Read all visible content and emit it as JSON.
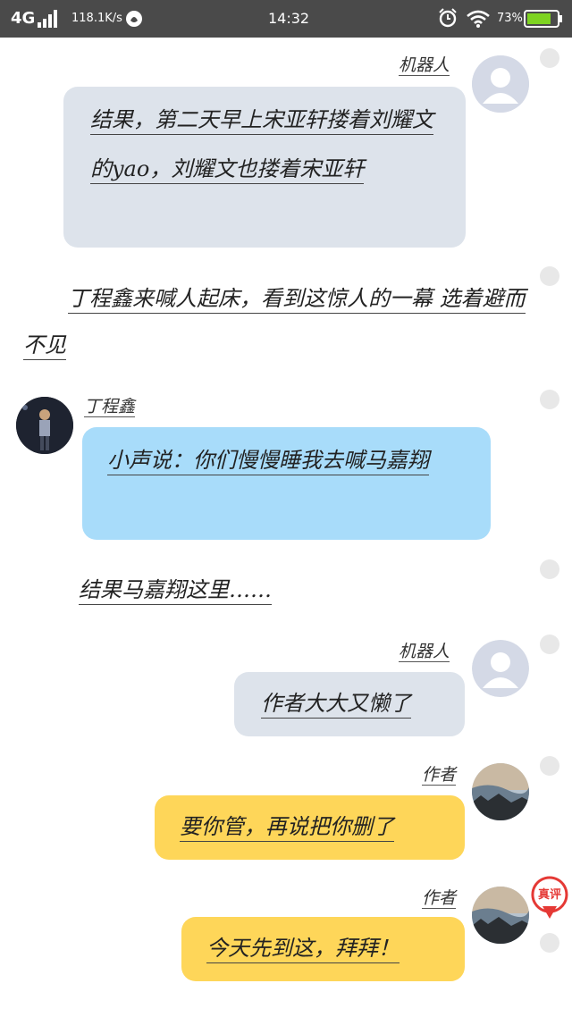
{
  "status_bar": {
    "network": "4G",
    "speed": "118.1K/s",
    "time": "14:32",
    "battery_pct": "73%",
    "bg_color": "#4a4a4a"
  },
  "messages": [
    {
      "sender": "机器人",
      "text": "结果，第二天早上宋亚轩搂着刘耀文的yao，刘耀文也搂着宋亚轩"
    },
    {
      "narration": "丁程鑫来喊人起床，看到这惊人的一幕 选着避而不见"
    },
    {
      "sender": "丁程鑫",
      "text": "小声说：你们慢慢睡我去喊马嘉翔"
    },
    {
      "narration": "结果马嘉翔这里……"
    },
    {
      "sender": "机器人",
      "text": "作者大大又懒了"
    },
    {
      "sender": "作者",
      "text": "要你管，再说把你删了"
    },
    {
      "sender": "作者",
      "text": "今天先到这，拜拜！"
    }
  ],
  "badge": {
    "label": "真评",
    "color": "#e53935"
  },
  "colors": {
    "bubble_gray": "#dde3eb",
    "bubble_blue": "#a8dcfa",
    "bubble_yellow": "#fed659"
  },
  "icons": [
    "signal-icon",
    "app-icon",
    "alarm-icon",
    "wifi-icon",
    "battery-icon",
    "robot-avatar-icon"
  ]
}
